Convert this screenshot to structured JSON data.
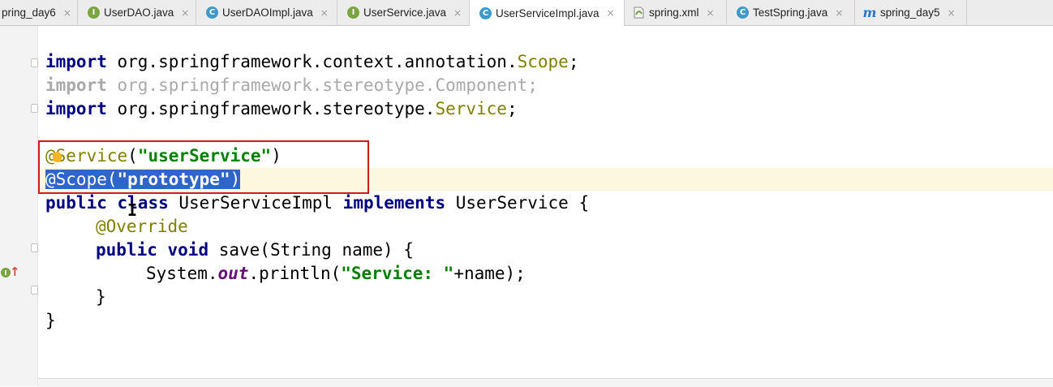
{
  "tabs": [
    {
      "label": "pring_day6",
      "icon": "maven-module-icon"
    },
    {
      "label": "UserDAO.java",
      "icon": "interface-icon",
      "glyph": "I"
    },
    {
      "label": "UserDAOImpl.java",
      "icon": "class-icon",
      "glyph": "C"
    },
    {
      "label": "UserService.java",
      "icon": "interface-icon",
      "glyph": "I"
    },
    {
      "label": "UserServiceImpl.java",
      "icon": "class-icon",
      "glyph": "C",
      "active": true
    },
    {
      "label": "spring.xml",
      "icon": "xml-icon"
    },
    {
      "label": "TestSpring.java",
      "icon": "test-class-icon",
      "glyph": "C"
    },
    {
      "label": "spring_day5",
      "icon": "maven-module-icon",
      "glyph": "m"
    }
  ],
  "close_glyph": "×",
  "gutter": {
    "implements_glyph": "I",
    "arrow_glyph": "↑"
  },
  "code": {
    "l1": {
      "kw": "import",
      "pkg": " org.springframework.context.annotation.",
      "cls": "Scope",
      "semi": ";"
    },
    "l2": {
      "kw": "import",
      "rest": " org.springframework.stereotype.Component;"
    },
    "l3": {
      "kw": "import",
      "pkg": " org.springframework.stereotype.",
      "cls": "Service",
      "semi": ";"
    },
    "l4": {
      "at": "@",
      "name": "Service",
      "open": "(",
      "str": "\"userService\"",
      "close": ")"
    },
    "l5": {
      "ann": "@Scope(",
      "str": "\"prototype\"",
      "close": ")"
    },
    "l6": {
      "kw1": "public",
      "sp1": " ",
      "kw2": "class",
      "name": " UserServiceImpl ",
      "kw3": "implements",
      "rest": " UserService {"
    },
    "l7": {
      "ann": "@Override"
    },
    "l8": {
      "kw1": "public",
      "sp": " ",
      "kw2": "void",
      "rest": " save(String name) {"
    },
    "l9": {
      "pre": "System.",
      "field": "out",
      "mid": ".println(",
      "str": "\"Service: \"",
      "post": "+name);"
    },
    "l10": {
      "brace": "}"
    },
    "l11": {
      "brace": "}"
    }
  },
  "colors": {
    "keyword": "#000080",
    "string": "#008000",
    "annotation": "#808000",
    "selection": "#2f65ca",
    "highlight_box": "#d11b1b"
  }
}
